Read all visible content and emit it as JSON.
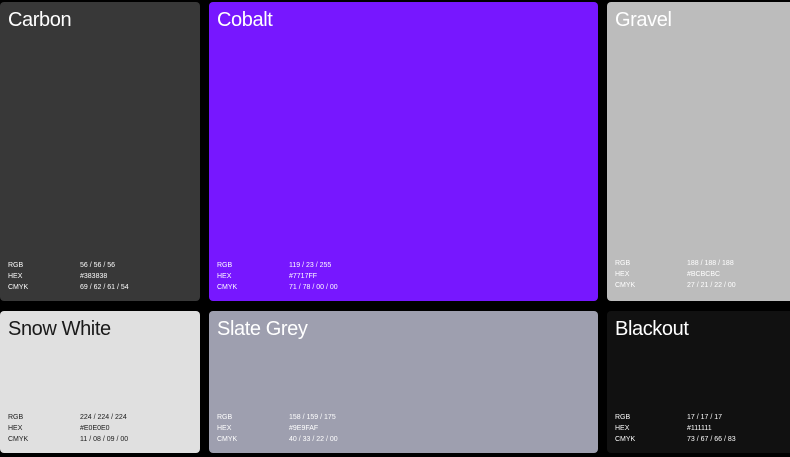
{
  "swatches": [
    {
      "name": "Carbon",
      "bg": "#383838",
      "text_color": "#FFFFFF",
      "specs": [
        {
          "label": "RGB",
          "value": "56 / 56 / 56"
        },
        {
          "label": "HEX",
          "value": "#383838"
        },
        {
          "label": "CMYK",
          "value": "69 / 62 / 61 / 54"
        }
      ]
    },
    {
      "name": "Cobalt",
      "bg": "#7717FF",
      "text_color": "#FFFFFF",
      "specs": [
        {
          "label": "RGB",
          "value": "119 / 23 / 255"
        },
        {
          "label": "HEX",
          "value": "#7717FF"
        },
        {
          "label": "CMYK",
          "value": "71 / 78 / 00 / 00"
        }
      ]
    },
    {
      "name": "Gravel",
      "bg": "#BCBCBC",
      "text_color": "#FFFFFF",
      "specs": [
        {
          "label": "RGB",
          "value": "188 / 188 / 188"
        },
        {
          "label": "HEX",
          "value": "#BCBCBC"
        },
        {
          "label": "CMYK",
          "value": "27 / 21 / 22 / 00"
        }
      ]
    },
    {
      "name": "Snow White",
      "bg": "#E0E0E0",
      "text_color": "#1A1A1A",
      "specs": [
        {
          "label": "RGB",
          "value": "224 / 224 / 224"
        },
        {
          "label": "HEX",
          "value": "#E0E0E0"
        },
        {
          "label": "CMYK",
          "value": "11 / 08 / 09 / 00"
        }
      ]
    },
    {
      "name": "Slate Grey",
      "bg": "#9E9FAF",
      "text_color": "#FFFFFF",
      "specs": [
        {
          "label": "RGB",
          "value": "158 / 159 / 175"
        },
        {
          "label": "HEX",
          "value": "#9E9FAF"
        },
        {
          "label": "CMYK",
          "value": "40 / 33 / 22 / 00"
        }
      ]
    },
    {
      "name": "Blackout",
      "bg": "#111111",
      "text_color": "#FFFFFF",
      "specs": [
        {
          "label": "RGB",
          "value": "17 / 17 / 17"
        },
        {
          "label": "HEX",
          "value": "#111111"
        },
        {
          "label": "CMYK",
          "value": "73 / 67 / 66 / 83"
        }
      ]
    }
  ]
}
